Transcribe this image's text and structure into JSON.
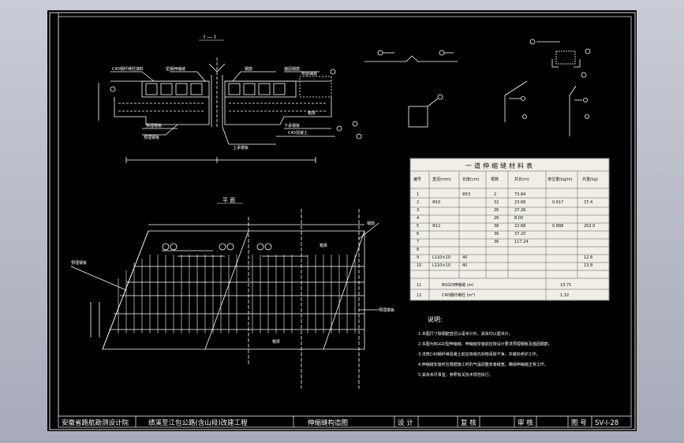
{
  "title_block": {
    "institute": "安徽省路航勘测设计院",
    "project": "绩溪至江包公路(含山段)改建工程",
    "drawing_name": "伸缩缝构造图",
    "design_label": "设 计",
    "check_label": "复 核",
    "review_label": "审 核",
    "figno_label": "图 号",
    "figno": "SV-I-28"
  },
  "section": {
    "title": "I — I",
    "labels": [
      "C40钢纤维砼填料",
      "型钢伸缩缝",
      "钢筋",
      "锚固钢筋",
      "预埋钢板",
      "预埋钢板",
      "箱梁",
      "下承钢板",
      "上承钢板",
      "桥面铺装",
      "C40混凝土"
    ]
  },
  "plan": {
    "title": "平 面",
    "labels": [
      "预埋钢板",
      "预埋钢板",
      "钢筋",
      "箱梁",
      "箱梁"
    ]
  },
  "table": {
    "title": "一道伸缩缝材料表",
    "headers": [
      "编号",
      "直径(mm)",
      "长度(cm)",
      "根数",
      "共长(m)",
      "单位重(kg/m)",
      "共重(kg)"
    ],
    "rows": [
      [
        "1",
        "",
        "Φ53",
        "2",
        "73.84",
        "",
        ""
      ],
      [
        "2",
        "Φ10",
        "",
        "32",
        "23.68",
        "0.617",
        "37.4"
      ],
      [
        "3",
        "",
        "",
        "26",
        "27.26",
        "",
        ""
      ],
      [
        "4",
        "",
        "",
        "26",
        "8.00",
        "",
        ""
      ],
      [
        "5",
        "Φ12",
        "",
        "38",
        "22.68",
        "0.888",
        "202.0"
      ],
      [
        "6",
        "",
        "",
        "36",
        "37.20",
        "",
        ""
      ],
      [
        "7",
        "",
        "",
        "36",
        "117.24",
        "",
        ""
      ],
      [
        "8",
        "",
        "",
        "",
        "",
        "",
        ""
      ],
      [
        "9",
        "L110×10",
        "40",
        "",
        "",
        "",
        "12.8"
      ],
      [
        "10",
        "L110×10",
        "40",
        "",
        "",
        "",
        "13.8"
      ]
    ],
    "extra_rows": [
      {
        "no": "11",
        "label": "BGGD伸缩缝 (m)",
        "value": "13.71"
      },
      {
        "no": "12",
        "label": "C40钢纤维砼 (m³)",
        "value": "1.32"
      }
    ]
  },
  "notes": {
    "title": "说明:",
    "items": [
      "1.本图尺寸除钢筋直径以毫米计外，其余均以厘米计。",
      "2.本图为BGGD型伸缩缝。伸缩缝安装前应按设计要求预埋钢板及锚固钢筋。",
      "3.浇筑C40钢纤维混凝土前应将缝内杂物清除干净，并做好养护工作。",
      "4.伸缩缝安装时应根据施工时的气温调整安装缝宽，确保伸缩缝正常工作。",
      "5.其余未尽事宜，参照有关技术规范执行。"
    ]
  }
}
